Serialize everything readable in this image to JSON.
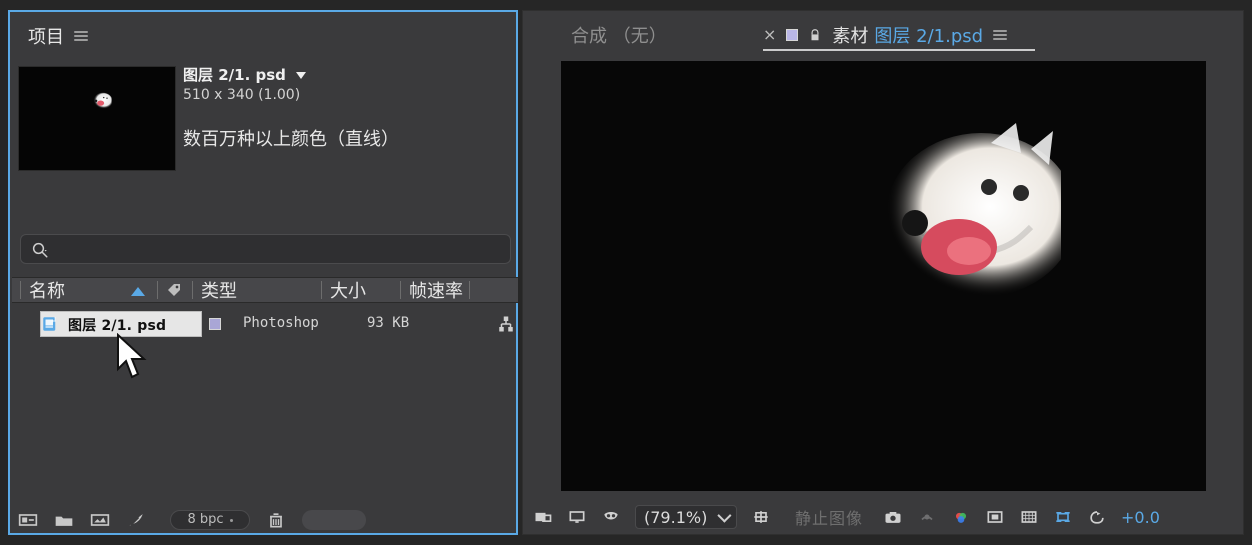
{
  "left_panel": {
    "title": "项目",
    "selected_item": {
      "name": "图层 2/1. psd",
      "dimensions": "510 x 340 (1.00)",
      "color_mode": "数百万种以上颜色（直线）"
    },
    "columns": {
      "name": "名称",
      "type": "类型",
      "size": "大小",
      "frame_rate": "帧速率"
    },
    "rows": [
      {
        "name": "图层 2/1. psd",
        "type": "Photoshop",
        "size": "93 KB"
      }
    ],
    "footer": {
      "bpc": "8 bpc"
    }
  },
  "right_panel": {
    "tabs": {
      "composition": "合成 （无）",
      "footage_prefix": "素材",
      "footage_name": "图层 2/1.psd"
    },
    "toolbar": {
      "zoom": "(79.1%)",
      "snapshot_label": "静止图像",
      "exposure": "+0.0"
    }
  },
  "colors": {
    "accent_blue": "#5aa9e6",
    "label_swatch": "#a9a6d6"
  }
}
